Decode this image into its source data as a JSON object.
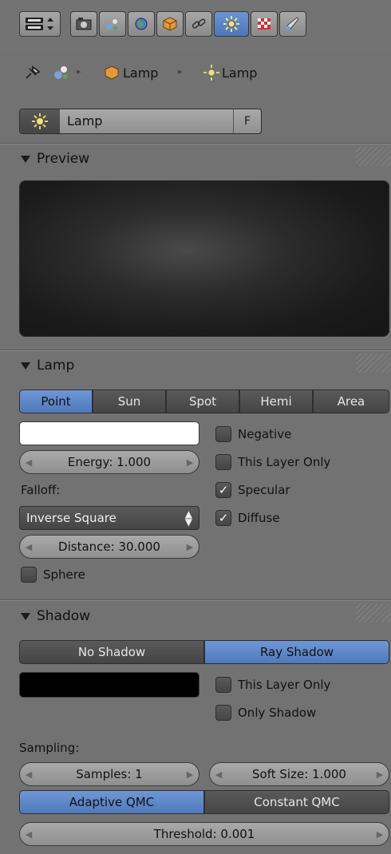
{
  "header": {
    "editor_type_icon": "editor-type-icon",
    "tabs": [
      {
        "name": "render-icon"
      },
      {
        "name": "scene-icon"
      },
      {
        "name": "world-icon"
      },
      {
        "name": "object-icon"
      },
      {
        "name": "constraint-icon"
      },
      {
        "name": "lamp-data-icon",
        "selected": true
      },
      {
        "name": "texture-icon"
      },
      {
        "name": "brush-icon"
      }
    ]
  },
  "breadcrumb": {
    "items": [
      "",
      "Lamp",
      "Lamp"
    ]
  },
  "datablock": {
    "name": "Lamp",
    "fake_user": "F"
  },
  "preview": {
    "title": "Preview"
  },
  "lamp": {
    "title": "Lamp",
    "types": [
      "Point",
      "Sun",
      "Spot",
      "Hemi",
      "Area"
    ],
    "selected_type": "Point",
    "color": "#ffffff",
    "energy": "Energy: 1.000",
    "falloff_label": "Falloff:",
    "falloff_value": "Inverse Square",
    "distance": "Distance: 30.000",
    "sphere": "Sphere",
    "negative": "Negative",
    "this_layer_only": "This Layer Only",
    "specular": "Specular",
    "diffuse": "Diffuse",
    "checks": {
      "negative": false,
      "this_layer_only": false,
      "specular": true,
      "diffuse": true,
      "sphere": false
    }
  },
  "shadow": {
    "title": "Shadow",
    "modes": [
      "No Shadow",
      "Ray Shadow"
    ],
    "selected_mode": "Ray Shadow",
    "color": "#000000",
    "this_layer_only": "This Layer Only",
    "only_shadow": "Only Shadow",
    "sampling_label": "Sampling:",
    "samples": "Samples: 1",
    "soft_size": "Soft Size: 1.000",
    "qmc": [
      "Adaptive QMC",
      "Constant QMC"
    ],
    "selected_qmc": "Adaptive QMC",
    "threshold": "Threshold: 0.001"
  },
  "colors": {
    "accent": "#5b84c6",
    "panel_bg": "#727272"
  }
}
